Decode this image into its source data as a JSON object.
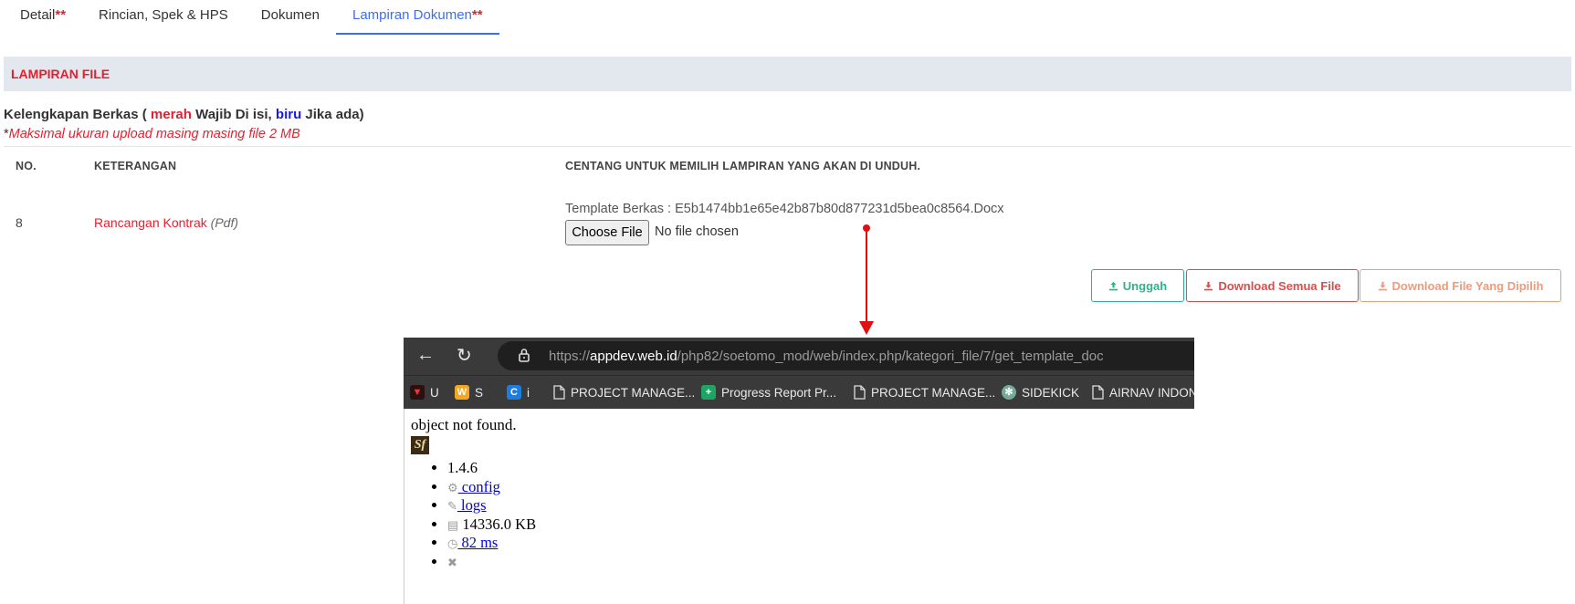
{
  "tabs": [
    {
      "label": "Detail",
      "required": "**"
    },
    {
      "label": "Rincian, Spek & HPS",
      "required": ""
    },
    {
      "label": "Dokumen",
      "required": ""
    },
    {
      "label": "Lampiran Dokumen",
      "required": "**"
    }
  ],
  "section_title": "LAMPIRAN FILE",
  "kelengkapan": {
    "prefix": "Kelengkapan Berkas ( ",
    "red_word": "merah",
    "mid": " Wajib Di isi, ",
    "blue_word": "biru",
    "suffix": " Jika ada)"
  },
  "note": {
    "star": "*",
    "text": "Maksimal ukuran upload masing masing file 2 MB"
  },
  "table": {
    "headers": [
      "NO.",
      "KETERANGAN",
      "CENTANG UNTUK MEMILIH LAMPIRAN YANG AKAN DI UNDUH."
    ],
    "rows": [
      {
        "no": "8",
        "keterangan": "Rancangan Kontrak",
        "format": "(Pdf)",
        "template": "Template Berkas : E5b1474bb1e65e42b87b80d877231d5bea0c8564.Docx",
        "choose_label": "Choose File",
        "file_status": "No file chosen"
      }
    ]
  },
  "buttons": {
    "upload": "Unggah",
    "download_all": "Download Semua File",
    "download_selected": "Download File Yang Dipilih"
  },
  "browser": {
    "url_scheme": "https://",
    "url_host": "appdev.web.id",
    "url_path": "/php82/soetomo_mod/web/index.php/kategori_file/7/get_template_doc",
    "bookmarks": [
      {
        "label": "U",
        "icon": "red-app-icon"
      },
      {
        "label": "S",
        "icon": "w-app-icon"
      },
      {
        "label": "i",
        "icon": "c-app-icon"
      },
      {
        "label": "PROJECT MANAGE...",
        "icon": "page-icon"
      },
      {
        "label": "Progress Report Pr...",
        "icon": "sheets-icon"
      },
      {
        "label": "PROJECT MANAGE...",
        "icon": "page-icon"
      },
      {
        "label": "SIDEKICK",
        "icon": "openai-icon"
      },
      {
        "label": "AIRNAV INDON",
        "icon": "page-icon"
      }
    ],
    "message": "object not found.",
    "sf_logo": "Sf",
    "debug": {
      "version": "1.4.6",
      "config": "config",
      "logs": "logs",
      "memory": "14336.0 KB",
      "time": "82 ms"
    }
  }
}
